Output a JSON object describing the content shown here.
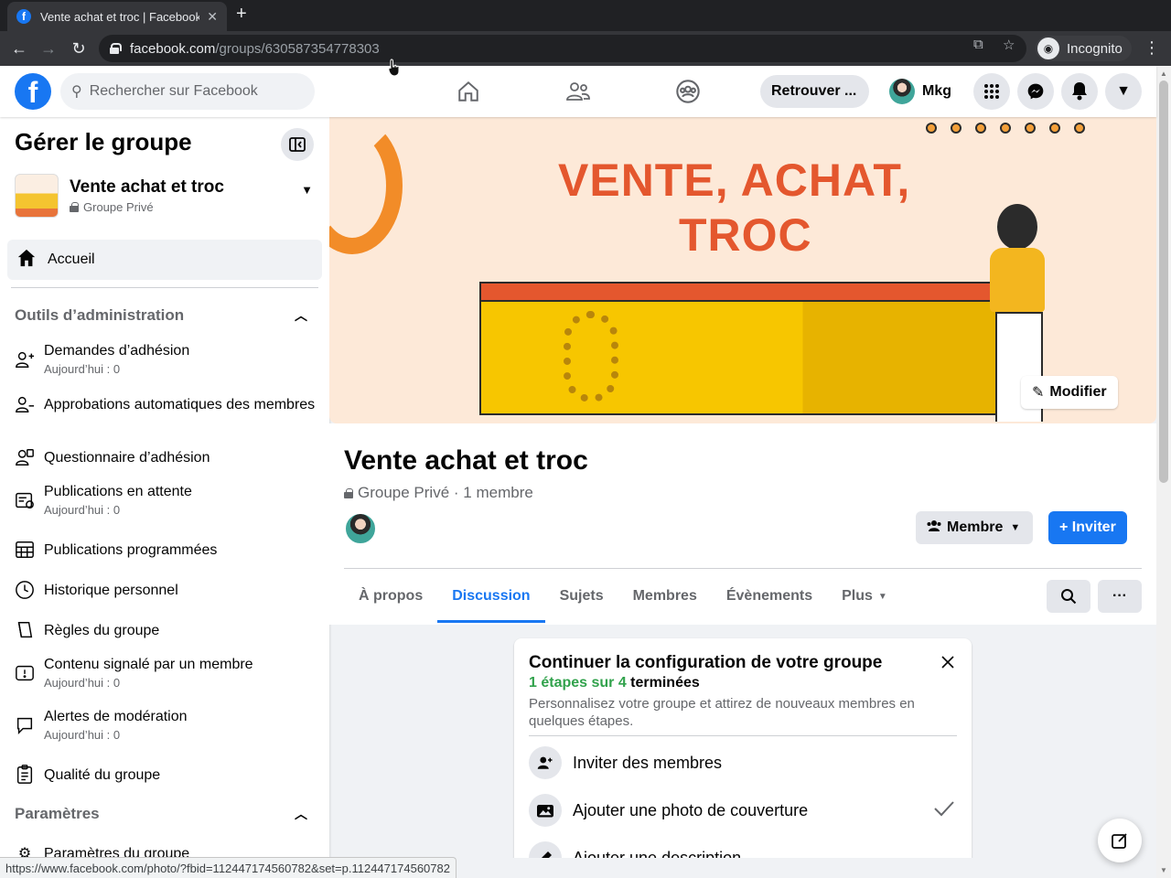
{
  "browser": {
    "tab_title": "Vente achat et troc | Facebook",
    "url_domain": "facebook.com",
    "url_path": "/groups/630587354778303",
    "incognito_label": "Incognito",
    "status_url": "https://www.facebook.com/photo/?fbid=112447174560782&set=p.112447174560782"
  },
  "header": {
    "search_placeholder": "Rechercher sur Facebook",
    "retrouver_label": "Retrouver ...",
    "profile_name": "Mkg"
  },
  "sidebar": {
    "title": "Gérer le groupe",
    "group_name": "Vente achat et troc",
    "group_privacy": "Groupe Privé",
    "home_label": "Accueil",
    "admin_section": "Outils d’administration",
    "items": [
      {
        "label": "Demandes d’adhésion",
        "sub": "Aujourd’hui : 0"
      },
      {
        "label": "Approbations automatiques des membres",
        "sub": ""
      },
      {
        "label": "Questionnaire d’adhésion",
        "sub": ""
      },
      {
        "label": "Publications en attente",
        "sub": "Aujourd’hui : 0"
      },
      {
        "label": "Publications programmées",
        "sub": ""
      },
      {
        "label": "Historique personnel",
        "sub": ""
      },
      {
        "label": "Règles du groupe",
        "sub": ""
      },
      {
        "label": "Contenu signalé par un membre",
        "sub": "Aujourd’hui : 0"
      },
      {
        "label": "Alertes de modération",
        "sub": "Aujourd’hui : 0"
      },
      {
        "label": "Qualité du groupe",
        "sub": ""
      }
    ],
    "settings_section": "Paramètres",
    "settings_item": "Paramètres du groupe"
  },
  "cover": {
    "line1": "VENTE, ACHAT,",
    "line2": "TROC",
    "edit_label": "Modifier"
  },
  "group": {
    "title": "Vente achat et troc",
    "privacy": "Groupe Privé",
    "members": "· 1 membre",
    "member_button": "Membre",
    "invite_button": "+ Inviter",
    "tabs": [
      "À propos",
      "Discussion",
      "Sujets",
      "Membres",
      "Évènements",
      "Plus"
    ]
  },
  "setup_card": {
    "title": "Continuer la configuration de votre groupe",
    "progress_done": "1 étapes sur 4",
    "progress_rest": " terminées",
    "description": "Personnalisez votre groupe et attirez de nouveaux membres en quelques étapes.",
    "steps": [
      {
        "label": "Inviter des membres",
        "done": false
      },
      {
        "label": "Ajouter une photo de couverture",
        "done": true
      },
      {
        "label": "Ajouter une description",
        "done": false
      }
    ]
  },
  "colors": {
    "fb_blue": "#1877f2",
    "progress_green": "#31a24c",
    "cover_orange": "#e4572e"
  }
}
